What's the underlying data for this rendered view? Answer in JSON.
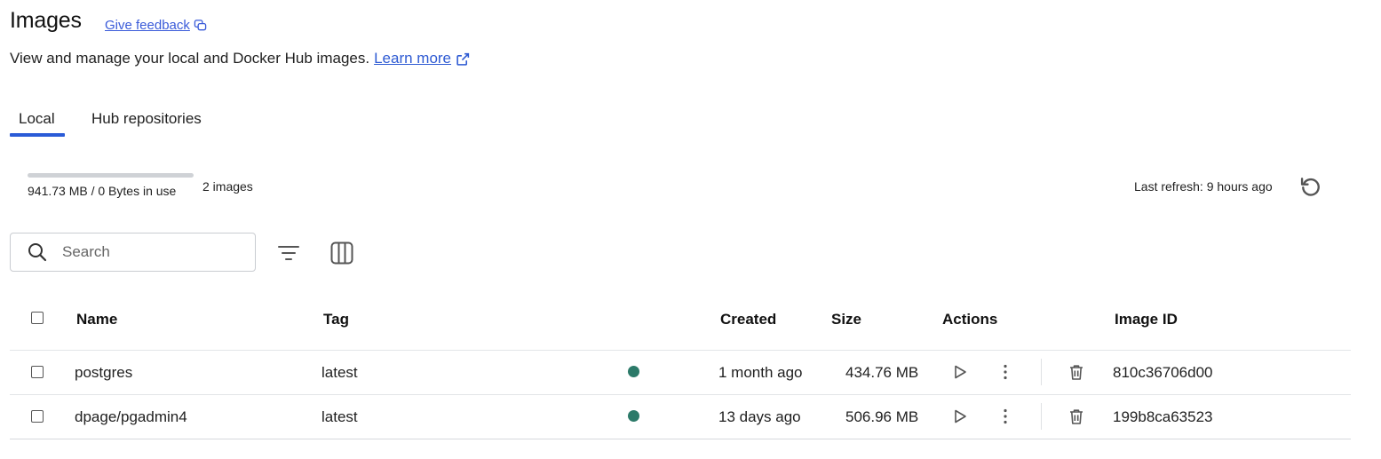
{
  "header": {
    "title": "Images",
    "feedback_link": "Give feedback",
    "subtitle": "View and manage your local and Docker Hub images.",
    "learn_more": "Learn more"
  },
  "tabs": [
    {
      "label": "Local",
      "active": true
    },
    {
      "label": "Hub repositories",
      "active": false
    }
  ],
  "usage": {
    "text": "941.73 MB / 0 Bytes in use",
    "count": "2 images",
    "fill_fraction": 0
  },
  "refresh": {
    "text": "Last refresh: 9 hours ago"
  },
  "search": {
    "placeholder": "Search",
    "value": ""
  },
  "table": {
    "columns": [
      "Name",
      "Tag",
      "Created",
      "Size",
      "Actions",
      "Image ID"
    ],
    "rows": [
      {
        "name": "postgres",
        "tag": "latest",
        "status": "in-use",
        "created": "1 month ago",
        "size": "434.76 MB",
        "image_id": "810c36706d00"
      },
      {
        "name": "dpage/pgadmin4",
        "tag": "latest",
        "status": "in-use",
        "created": "13 days ago",
        "size": "506.96 MB",
        "image_id": "199b8ca63523"
      }
    ]
  },
  "colors": {
    "accent": "#2a5bd7",
    "status_in_use": "#2c7a69",
    "link": "#2f5bd3"
  },
  "icons": {
    "feedback": "feedback-icon",
    "external_link": "external-link-icon",
    "refresh": "refresh-icon",
    "search": "search-icon",
    "filter": "filter-icon",
    "columns": "columns-icon",
    "run": "play-icon",
    "more": "more-vertical-icon",
    "delete": "trash-icon"
  }
}
